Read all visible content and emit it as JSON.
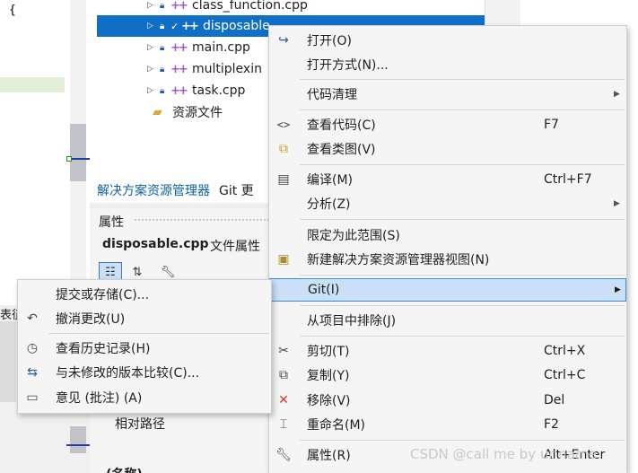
{
  "editor": {
    "brace": "{"
  },
  "solution_explorer": {
    "items": [
      {
        "name": "class_function.cpp",
        "selected": false
      },
      {
        "name": "disposable",
        "selected": true
      },
      {
        "name": "main.cpp",
        "selected": false
      },
      {
        "name": "multiplexin",
        "selected": false
      },
      {
        "name": "task.cpp",
        "selected": false
      }
    ],
    "folder": "资源文件",
    "tabs": [
      "解决方案资源管理器",
      "Git 更"
    ]
  },
  "properties": {
    "title": "属性",
    "subject": "disposable.cpp",
    "subject_kind": "文件属性",
    "relative_path": "相对路径",
    "name_category": "(名称)"
  },
  "left_label": "表征",
  "context_menu": {
    "open": "打开(O)",
    "open_with": "打开方式(N)...",
    "code_cleanup": "代码清理",
    "view_code": "查看代码(C)",
    "view_code_shortcut": "F7",
    "view_class_diagram": "查看类图(V)",
    "compile": "编译(M)",
    "compile_shortcut": "Ctrl+F7",
    "analyze": "分析(Z)",
    "scope_to_this": "限定为此范围(S)",
    "new_solution_view": "新建解决方案资源管理器视图(N)",
    "git": "Git(I)",
    "exclude_from_project": "从项目中排除(J)",
    "cut": "剪切(T)",
    "cut_shortcut": "Ctrl+X",
    "copy": "复制(Y)",
    "copy_shortcut": "Ctrl+C",
    "remove": "移除(V)",
    "remove_shortcut": "Del",
    "rename": "重命名(M)",
    "rename_shortcut": "F2",
    "properties": "属性(R)",
    "properties_shortcut": "Alt+Enter"
  },
  "git_submenu": {
    "commit_or_stash": "提交或存储(C)...",
    "undo_changes": "撤消更改(U)",
    "view_history": "查看历史记录(H)",
    "compare_unmodified": "与未修改的版本比较(C)...",
    "comment_annotate": "意见 (批注) (A)"
  },
  "watermark": "CSDN @call me by ur name"
}
